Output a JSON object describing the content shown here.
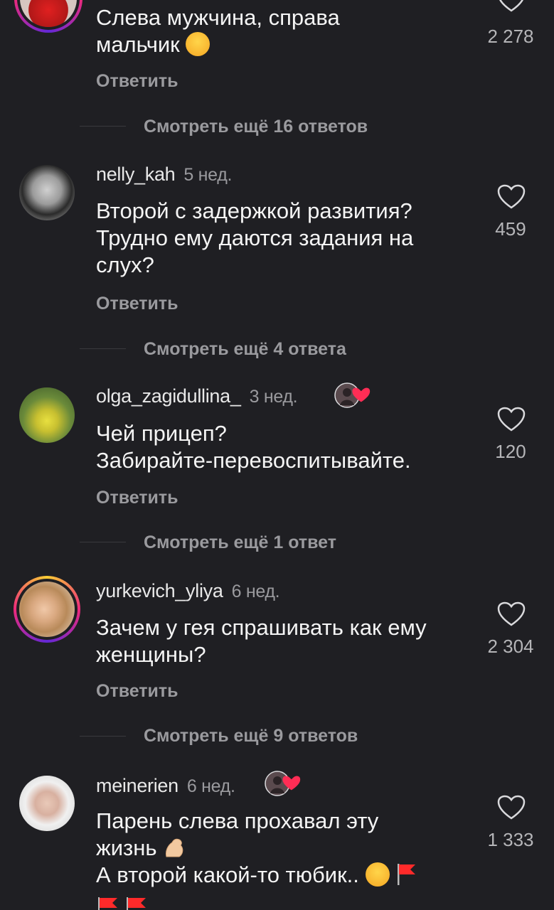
{
  "comments": [
    {
      "username": "",
      "time": "",
      "text_lines": [
        "Слева мужчина, справа",
        "мальчик"
      ],
      "emoji": "laughing-emoji",
      "likes": "2 278",
      "reply_label": "Ответить",
      "more_replies": "Смотреть ещё 16 ответов"
    },
    {
      "username": "nelly_kah",
      "time": "5 нед.",
      "text_lines": [
        "Второй с задержкой развития?",
        "Трудно ему даются задания на",
        "слух?"
      ],
      "likes": "459",
      "reply_label": "Ответить",
      "more_replies": "Смотреть ещё 4 ответа"
    },
    {
      "username": "olga_zagidullina_",
      "time": "3 нед.",
      "text_lines": [
        "Чей прицеп?",
        "Забирайте-перевоспитывайте."
      ],
      "likes": "120",
      "reply_label": "Ответить",
      "more_replies": "Смотреть ещё 1 ответ"
    },
    {
      "username": "yurkevich_yliya",
      "time": "6 нед.",
      "text_lines": [
        "Зачем у гея спрашивать как ему",
        "женщины?"
      ],
      "likes": "2 304",
      "reply_label": "Ответить",
      "more_replies": "Смотреть ещё 9 ответов"
    },
    {
      "username": "meinerien",
      "time": "6 нед.",
      "text_lines": [
        "Парень слева прохавал эту",
        "жизнь",
        "А второй какой-то тюбик.."
      ],
      "likes": "1 333"
    }
  ],
  "colors": {
    "background": "#1f1f23",
    "text": "#f4f4f4",
    "muted": "#9a9a9e",
    "heart_badge": "#ff2d55"
  }
}
